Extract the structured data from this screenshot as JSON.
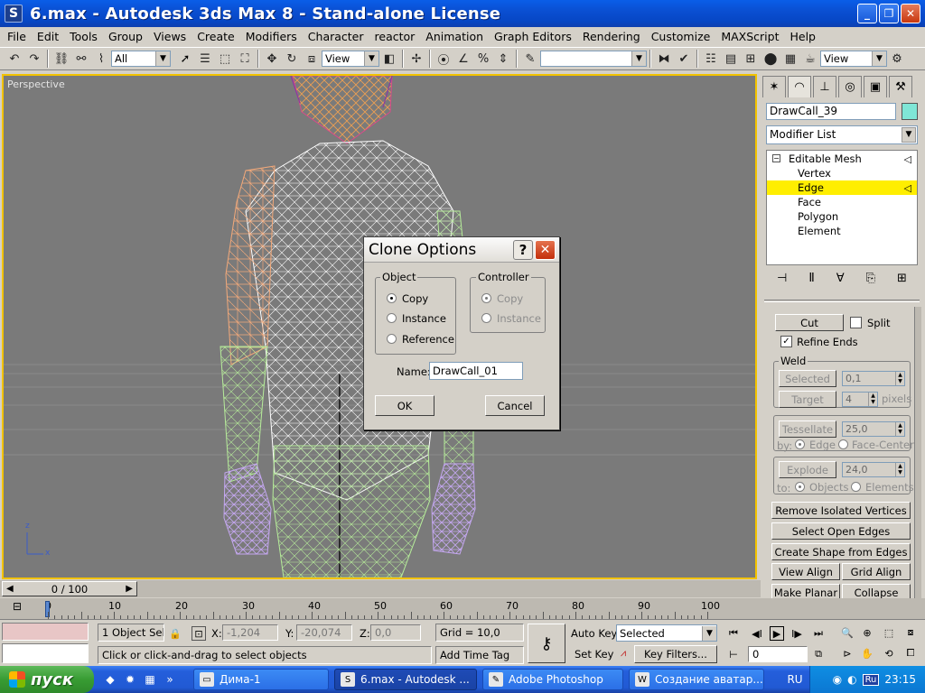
{
  "window": {
    "title": "6.max - Autodesk 3ds Max 8  - Stand-alone License",
    "app_icon": "S",
    "minimize": "_",
    "restore": "❐",
    "close": "✕"
  },
  "menu": [
    "File",
    "Edit",
    "Tools",
    "Group",
    "Views",
    "Create",
    "Modifiers",
    "Character",
    "reactor",
    "Animation",
    "Graph Editors",
    "Rendering",
    "Customize",
    "MAXScript",
    "Help"
  ],
  "toolbar": {
    "selection_filter": "All",
    "ref_coord": "View",
    "named_selection": "",
    "render_view": "View"
  },
  "viewport": {
    "label": "Perspective",
    "axis_z": "z",
    "axis_x": "x"
  },
  "command_panel": {
    "object_name": "DrawCall_39",
    "object_color": "#7fe6d6",
    "modifier_list": "Modifier List",
    "stack": {
      "root": "Editable Mesh",
      "root_box": "−",
      "items": [
        "Vertex",
        "Edge",
        "Face",
        "Polygon",
        "Element"
      ],
      "selected_item": "Edge"
    },
    "rollout": {
      "cut": "Cut",
      "split": "Split",
      "refine_ends": "Refine Ends",
      "refine_checked": "✓",
      "weld_title": "Weld",
      "selected_btn": "Selected",
      "selected_val": "0,1",
      "target_btn": "Target",
      "target_val": "4",
      "pixels": "pixels",
      "tessellate_btn": "Tessellate",
      "tessellate_val": "25,0",
      "by": "by:",
      "edge": "Edge",
      "face_center": "Face-Center",
      "explode_btn": "Explode",
      "explode_val": "24,0",
      "to": "to:",
      "objects": "Objects",
      "elements": "Elements",
      "remove_isolated": "Remove Isolated Vertices",
      "select_open_edges": "Select Open Edges",
      "create_shape": "Create Shape from Edges",
      "view_align": "View Align",
      "grid_align": "Grid Align",
      "make_planar": "Make Planar",
      "collapse": "Collapse"
    }
  },
  "dialog": {
    "title": "Clone Options",
    "help": "?",
    "close": "✕",
    "object_group": "Object",
    "controller_group": "Controller",
    "object_options": [
      "Copy",
      "Instance",
      "Reference"
    ],
    "controller_options": [
      "Copy",
      "Instance"
    ],
    "name_label": "Name:",
    "name_value": "DrawCall_01",
    "ok": "OK",
    "cancel": "Cancel"
  },
  "timeline": {
    "slider": "0 / 100",
    "ticks": [
      "0",
      "10",
      "20",
      "30",
      "40",
      "50",
      "60",
      "70",
      "80",
      "90",
      "100"
    ]
  },
  "status": {
    "objects_selected": "1 Object Sele",
    "x_label": "X:",
    "x_val": "-1,204",
    "y_label": "Y:",
    "y_val": "-20,074",
    "z_label": "Z:",
    "z_val": "0,0",
    "grid": "Grid = 10,0",
    "prompt": "Click or click-and-drag to select objects",
    "add_time_tag": "Add Time Tag",
    "auto_key": "Auto Key",
    "set_key": "Set Key",
    "key_mode": "Selected",
    "key_filters": "Key Filters...",
    "frame": "0"
  },
  "taskbar": {
    "start": "пуск",
    "tasks": [
      "Дима-1",
      "6.max - Autodesk ...",
      "Adobe Photoshop",
      "Создание аватар..."
    ],
    "lang": "RU",
    "tray_lang": "Ru",
    "clock": "23:15"
  }
}
